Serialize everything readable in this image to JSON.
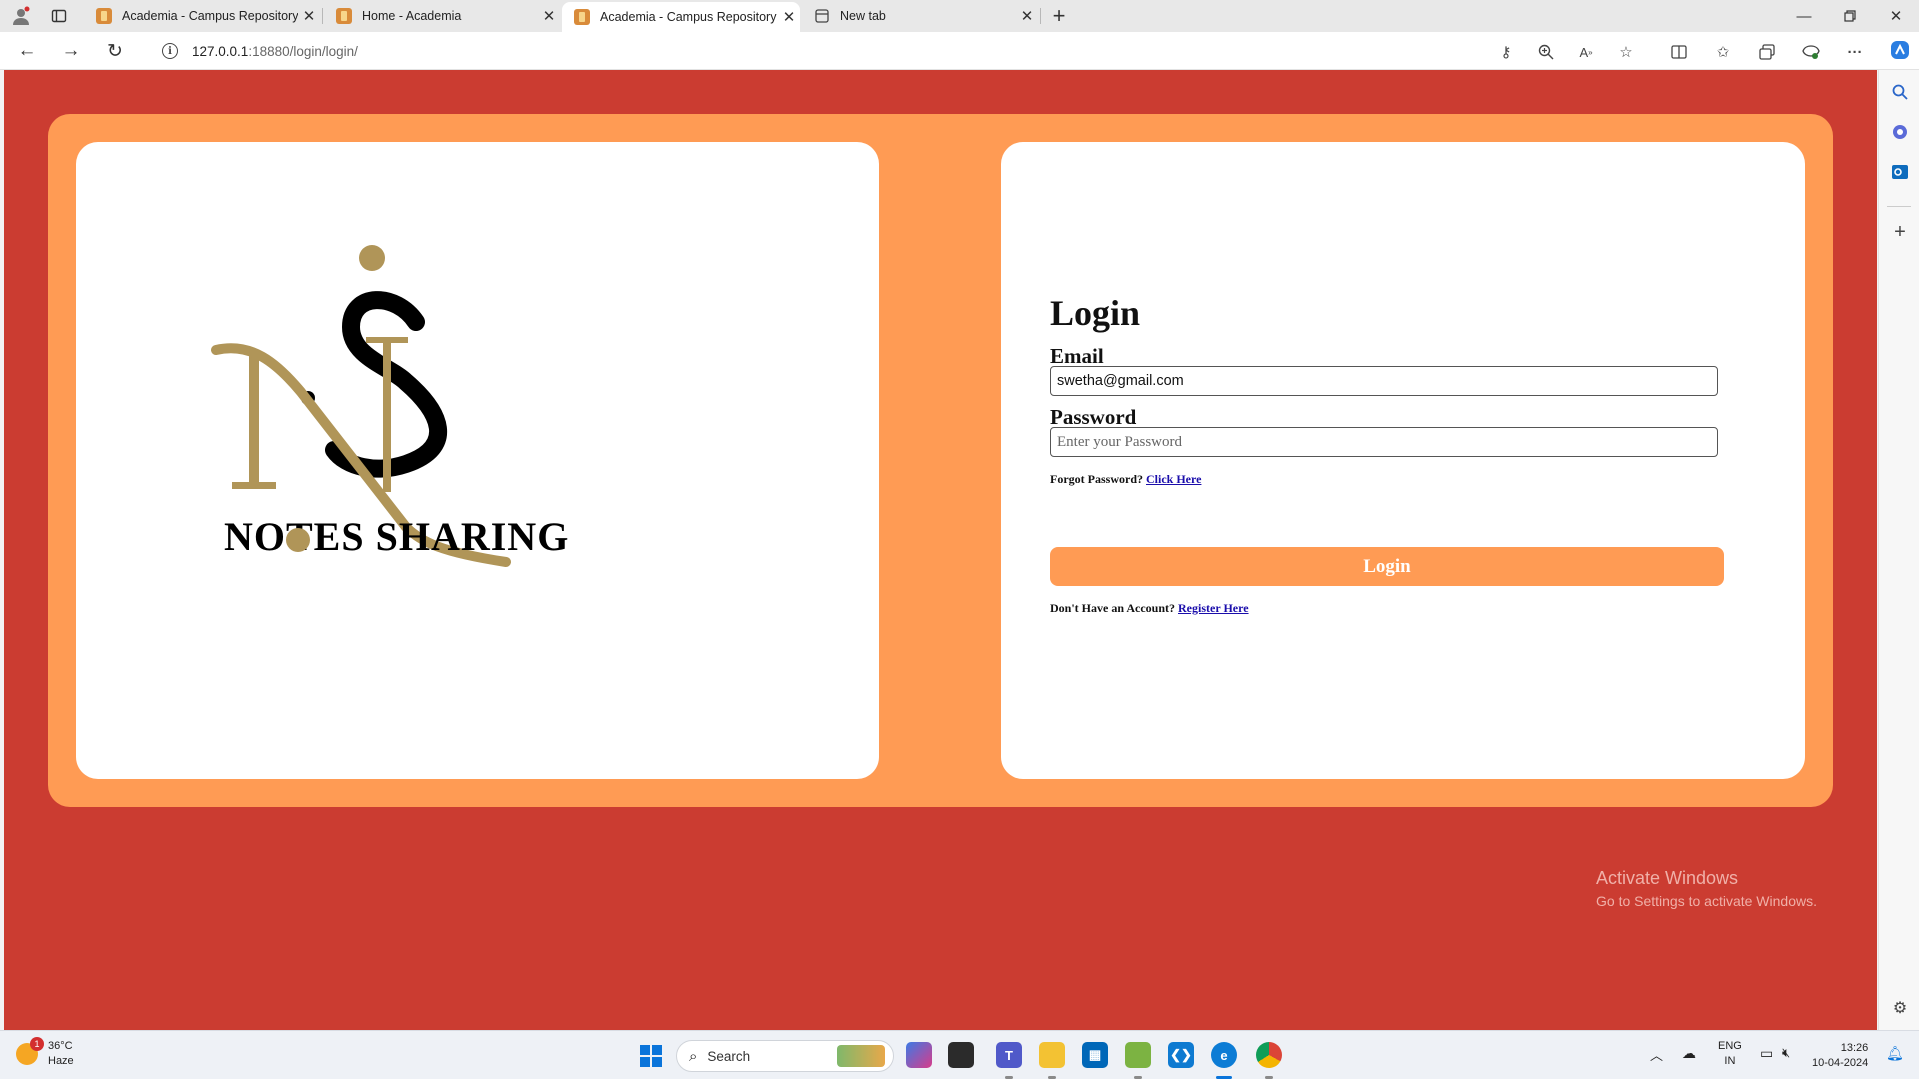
{
  "browser": {
    "tabs": [
      {
        "title": "Academia - Campus Repository",
        "active": false
      },
      {
        "title": "Home - Academia",
        "active": false
      },
      {
        "title": "Academia - Campus Repository",
        "active": true
      },
      {
        "title": "New tab",
        "active": false
      }
    ],
    "url_host": "127.0.0.1",
    "url_rest": ":18880/login/login/"
  },
  "logo": {
    "text": "NOTES SHARING",
    "colors": {
      "gold": "#b09558",
      "black": "#000000"
    }
  },
  "login": {
    "title": "Login",
    "email_label": "Email",
    "email_value": "swetha@gmail.com",
    "password_label": "Password",
    "password_placeholder": "Enter your Password",
    "forgot_text": "Forgot Password?",
    "forgot_link": "Click Here",
    "button_label": "Login",
    "register_text": "Don't Have an Account?",
    "register_link": "Register Here"
  },
  "watermark": {
    "line1": "Activate Windows",
    "line2": "Go to Settings to activate Windows."
  },
  "taskbar": {
    "temperature": "36°C",
    "condition": "Haze",
    "weather_badge": "1",
    "search_label": "Search",
    "lang_top": "ENG",
    "lang_bottom": "IN",
    "time": "13:26",
    "date": "10-04-2024"
  },
  "colors": {
    "page_bg": "#cb3c31",
    "card_border": "#ff9b54",
    "button": "#ff9b54",
    "link": "#1a0dab"
  }
}
